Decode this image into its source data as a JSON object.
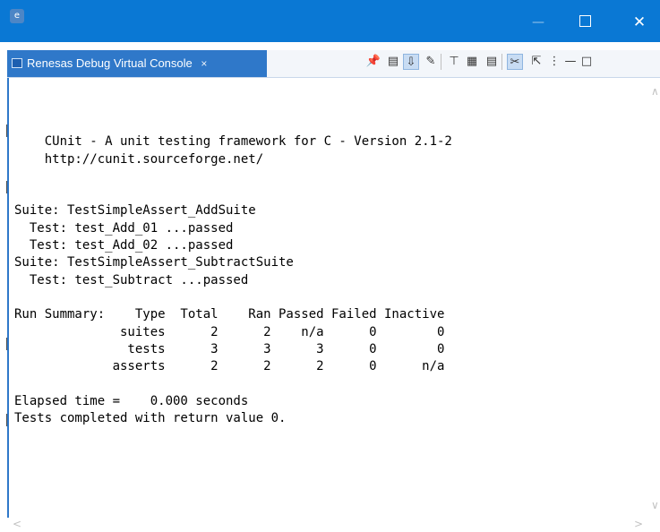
{
  "window": {
    "app_icon": "e",
    "minimize": "—",
    "close": "✕"
  },
  "tab": {
    "label": "Renesas Debug Virtual Console",
    "close": "×"
  },
  "toolbar": {
    "icons": [
      "pin-console-icon",
      "clear-console-icon",
      "scroll-lock-icon",
      "word-wrap-icon",
      "remove-launch-icon",
      "terminate-icon",
      "show-stdout-icon",
      "show-stderr-icon",
      "open-console-icon",
      "view-menu-icon",
      "minimize-view-icon",
      "maximize-view-icon"
    ]
  },
  "console": {
    "text": "\n    CUnit - A unit testing framework for C - Version 2.1-2\n    http://cunit.sourceforge.net/\n\n\nSuite: TestSimpleAssert_AddSuite\n  Test: test_Add_01 ...passed\n  Test: test_Add_02 ...passed\nSuite: TestSimpleAssert_SubtractSuite\n  Test: test_Subtract ...passed\n\nRun Summary:    Type  Total    Ran Passed Failed Inactive\n              suites      2      2    n/a      0        0\n               tests      3      3      3      0        0\n             asserts      2      2      2      0      n/a\n\nElapsed time =    0.000 seconds\nTests completed with return value 0."
  },
  "colors": {
    "titlebar": "#0a78d4",
    "tab_active": "#2f78c9",
    "console_bg": "#ffffff"
  }
}
